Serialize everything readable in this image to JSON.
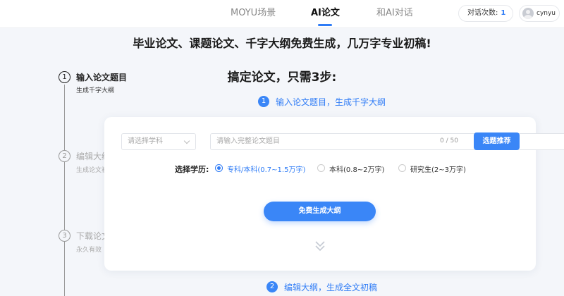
{
  "header": {
    "tabs": [
      {
        "label": "MOYU场景",
        "active": false
      },
      {
        "label": "AI论文",
        "active": true
      },
      {
        "label": "和AI对话",
        "active": false
      }
    ],
    "chat_count_label": "对话次数:",
    "chat_count": "1",
    "user_name": "cynyu",
    "avatar_icon": "avatar-icon"
  },
  "headline": "毕业论文、课题论文、千字大纲免费生成，几万字专业初稿!",
  "subtitle": "搞定论文，只需3步:",
  "steps": [
    {
      "num": "1",
      "title": "输入论文题目",
      "sub": "生成千字大纲",
      "active": true
    },
    {
      "num": "2",
      "title": "编辑大纲",
      "sub": "生成论文初稿",
      "active": false
    },
    {
      "num": "3",
      "title": "下载论文",
      "sub": "永久有效",
      "active": false
    }
  ],
  "center_steps": [
    {
      "num": "1",
      "text": "输入论文题目，生成千字大纲"
    },
    {
      "num": "2",
      "text": "编辑大纲，生成全文初稿"
    }
  ],
  "form": {
    "subject_placeholder": "请选择学科",
    "title_placeholder": "请输入完整论文题目",
    "char_counter": "0 / 50",
    "recommend_button": "选题推荐",
    "edu_label": "选择学历:",
    "edu_options": [
      {
        "label": "专科/本科(0.7~1.5万字)",
        "selected": true
      },
      {
        "label": "本科(0.8~2万字)",
        "selected": false
      },
      {
        "label": "研究生(2~3万字)",
        "selected": false
      }
    ],
    "generate_button": "免费生成大纲",
    "scroll_icon": "double-chevron-down-icon"
  },
  "colors": {
    "accent": "#3a86f7",
    "background": "#f4f6fa"
  }
}
